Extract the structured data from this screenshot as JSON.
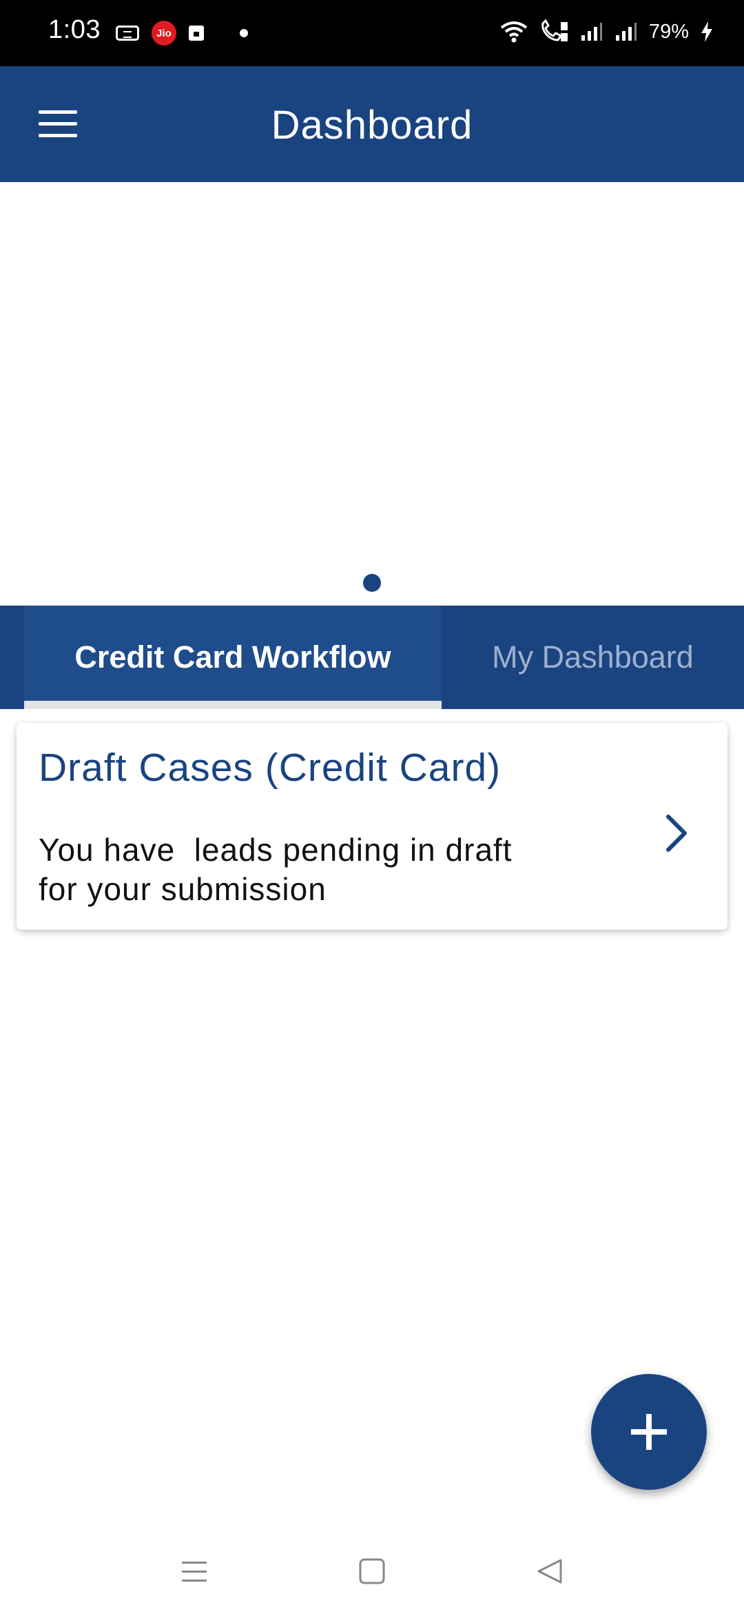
{
  "status_bar": {
    "time": "1:03",
    "carrier_badge": "Jio",
    "battery": "79%",
    "icons": [
      "card-icon",
      "jio-icon",
      "calendar-icon",
      "notification-dot-icon",
      "wifi-icon",
      "call-icon",
      "signal-icon",
      "signal-icon",
      "charging-icon"
    ]
  },
  "app_bar": {
    "title": "Dashboard",
    "menu_icon": "menu-icon"
  },
  "carousel": {
    "page_count": 1,
    "active_page": 1
  },
  "tabs": [
    {
      "label": "Credit Card Workflow",
      "selected": true
    },
    {
      "label": "My Dashboard",
      "selected": false
    }
  ],
  "card": {
    "title": "Draft Cases (Credit Card)",
    "description": "You have  leads pending in draft\nfor your submission",
    "chevron_icon": "chevron-right-icon"
  },
  "fab": {
    "icon": "plus-icon"
  },
  "nav_bar": {
    "items": [
      "recent-apps-icon",
      "home-icon",
      "back-icon"
    ]
  },
  "colors": {
    "primary": "#1a4480",
    "tab_inactive_text": "#9fb0cf",
    "tab_indicator": "#e4e4e4"
  }
}
